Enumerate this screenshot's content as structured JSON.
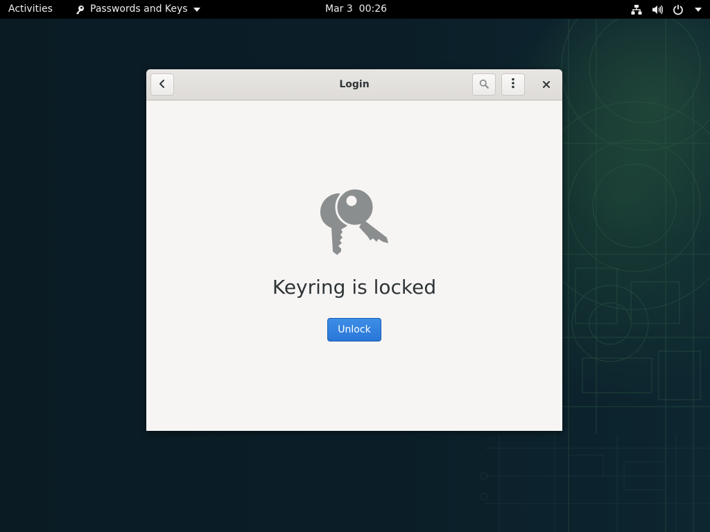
{
  "topbar": {
    "activities_label": "Activities",
    "app_name": "Passwords and Keys",
    "app_icon": "keys-icon",
    "clock": "Mar 3  00:26",
    "tray_icons": [
      "network-wired-icon",
      "volume-icon",
      "power-icon",
      "chevron-down-icon"
    ]
  },
  "window": {
    "title": "Login",
    "headerbar_buttons": [
      "back-icon",
      "search-icon",
      "menu-icon",
      "close-icon"
    ],
    "status": {
      "icon": "keys-icon",
      "title": "Keyring is locked",
      "action_label": "Unlock"
    }
  },
  "colors": {
    "topbar_bg": "#000000",
    "desktop_bg": "#0b1d26",
    "window_bg": "#f6f5f4",
    "accent": "#2a76d8",
    "icon_gray": "#8b8e8f",
    "text": "#2e3436"
  }
}
